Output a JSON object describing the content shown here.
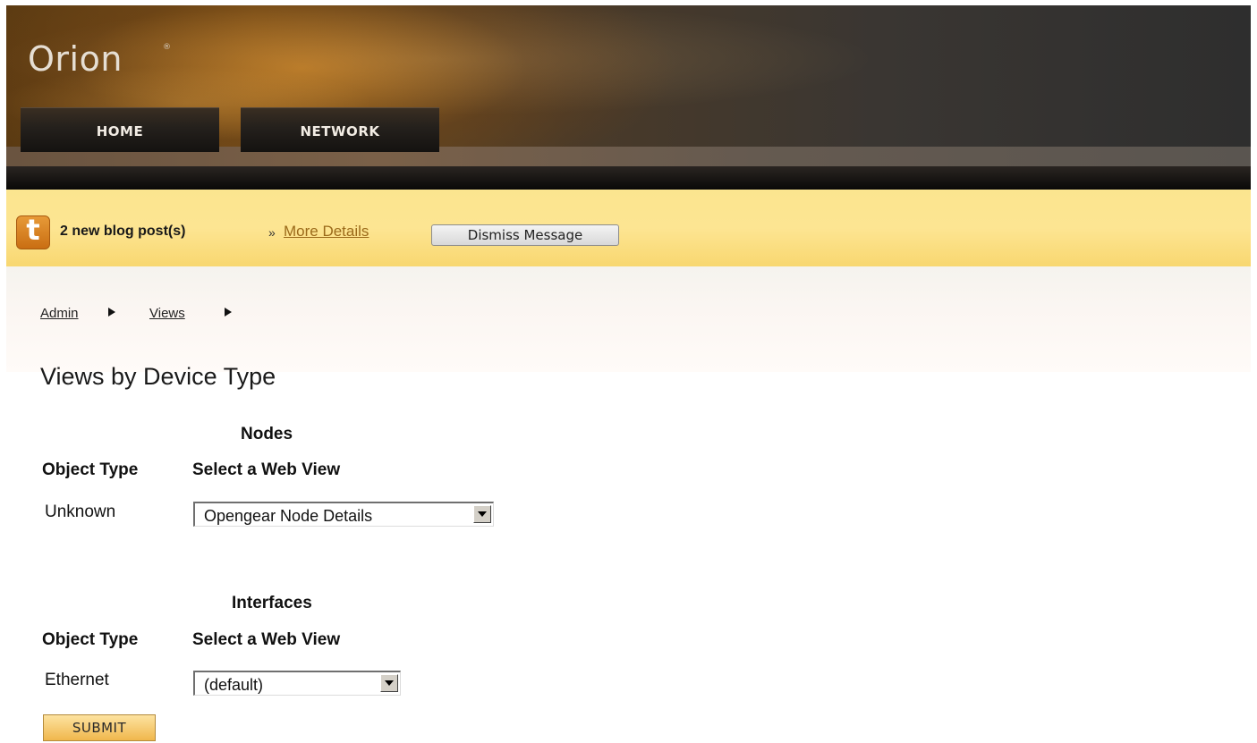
{
  "header": {
    "logo": "Orion",
    "logo_mark": "®",
    "nav": {
      "home_label": "HOME",
      "network_label": "NETWORK"
    }
  },
  "notification": {
    "icon_letter": "t",
    "message": "2 new blog post(s)",
    "separator": "»",
    "link_label": "More Details",
    "dismiss_label": "Dismiss Message"
  },
  "breadcrumb": {
    "items": [
      "Admin",
      "Views"
    ],
    "separator_icon": "triangle-right-icon"
  },
  "page": {
    "title": "Views by Device Type"
  },
  "sections": [
    {
      "title": "Nodes",
      "col_object_type": "Object Type",
      "col_web_view": "Select a Web View",
      "rows": [
        {
          "object_type": "Unknown",
          "selected_view": "Opengear Node Details"
        }
      ]
    },
    {
      "title": "Interfaces",
      "col_object_type": "Object Type",
      "col_web_view": "Select a Web View",
      "rows": [
        {
          "object_type": "Ethernet",
          "selected_view": "(default)"
        }
      ]
    }
  ],
  "form": {
    "submit_label": "SUBMIT"
  },
  "colors": {
    "notification_bg": "#fde592",
    "accent_orange": "#c96e12",
    "link_color": "#9b6a1a",
    "submit_bg": "#f0b74c"
  }
}
